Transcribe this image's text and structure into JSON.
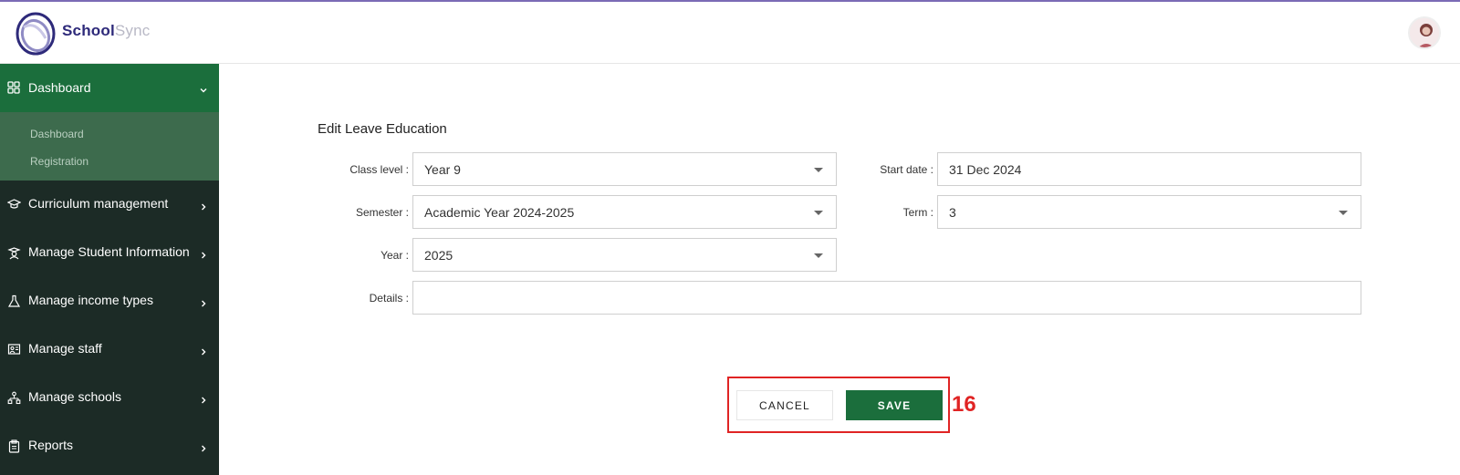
{
  "header": {
    "brand_part1": "School",
    "brand_part2": "Sync",
    "avatar_icon": "user-avatar"
  },
  "sidebar": {
    "active": {
      "label": "Dashboard",
      "icon": "grid-icon"
    },
    "submenu": [
      "Dashboard",
      "Registration"
    ],
    "items": [
      {
        "label": "Curriculum management",
        "icon": "graduation-cap-icon"
      },
      {
        "label": "Manage Student Information",
        "icon": "student-icon"
      },
      {
        "label": "Manage income types",
        "icon": "flask-icon"
      },
      {
        "label": "Manage staff",
        "icon": "staff-board-icon"
      },
      {
        "label": "Manage schools",
        "icon": "school-network-icon"
      },
      {
        "label": "Reports",
        "icon": "clipboard-icon"
      }
    ]
  },
  "form": {
    "title": "Edit Leave Education",
    "class_level": {
      "label": "Class level :",
      "value": "Year 9"
    },
    "semester": {
      "label": "Semester :",
      "value": "Academic Year 2024-2025"
    },
    "year": {
      "label": "Year :",
      "value": "2025"
    },
    "start_date": {
      "label": "Start date :",
      "value": "31 Dec 2024"
    },
    "term": {
      "label": "Term :",
      "value": "3"
    },
    "details": {
      "label": "Details :",
      "value": ""
    }
  },
  "actions": {
    "cancel_label": "CANCEL",
    "save_label": "SAVE",
    "marker": "16"
  },
  "colors": {
    "accent_green": "#1b6e3c",
    "sidebar_bg": "#1c2b26",
    "highlight_red": "#e02424"
  }
}
